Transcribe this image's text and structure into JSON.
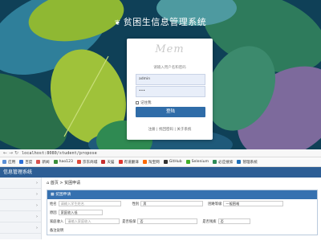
{
  "login_page": {
    "system_title": "贫困生信息管理系统",
    "logo_text": "Mem",
    "hint": "请输入用户名和密码",
    "username_value": "admin",
    "password_value": "•••",
    "remember_label": "记住我",
    "login_button": "登陆",
    "links": "注册 | 找回密码 | 关于系统"
  },
  "browser": {
    "back_icon": "back-arrow-icon",
    "forward_icon": "forward-arrow-icon",
    "reload_icon": "reload-icon",
    "url": "localhost:8080/student/propose",
    "bookmarks": [
      {
        "label": "应用",
        "color": "#5a8fd6"
      },
      {
        "label": "百度",
        "color": "#2d6fd7"
      },
      {
        "label": "新闻",
        "color": "#d9534f"
      },
      {
        "label": "hao123",
        "color": "#3a8e3a"
      },
      {
        "label": "京东商城",
        "color": "#e04b3a"
      },
      {
        "label": "天猫",
        "color": "#c62f2f"
      },
      {
        "label": "有道翻译",
        "color": "#e0352f"
      },
      {
        "label": "淘宝网",
        "color": "#ff6a00"
      },
      {
        "label": "GitHub",
        "color": "#333333"
      },
      {
        "label": "Selenium",
        "color": "#43b02a"
      },
      {
        "label": "必应搜索",
        "color": "#2e8b57"
      },
      {
        "label": "管理系统",
        "color": "#1e6fb8"
      }
    ]
  },
  "app": {
    "header_title": "信息管理系统",
    "breadcrumb": "首页 > 贫困申请",
    "panel_title": "贫困申请",
    "row1": {
      "name_label": "姓名",
      "name_placeholder": "请输入学生姓名",
      "gender_label": "性别",
      "gender_value": "男",
      "level_label": "困难等级",
      "level_value": "一般困难"
    },
    "row2": {
      "reason_label": "原因",
      "reason_placeholder": "家庭收入低"
    },
    "row3": {
      "income_label": "家庭收入",
      "income_placeholder": "请输入家庭收入",
      "other_label": "是否低保",
      "other_value": "否",
      "disabled_label": "是否残疾",
      "disabled_value": "否"
    },
    "row4": {
      "remark_label": "备注说明"
    },
    "sidebar_items": 5
  }
}
